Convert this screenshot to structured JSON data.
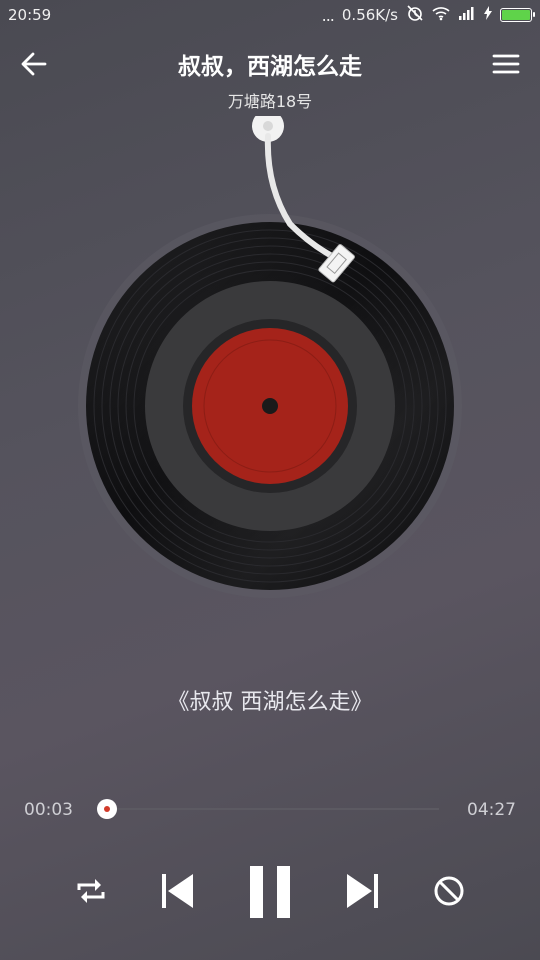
{
  "status_bar": {
    "time": "20:59",
    "dots": "...",
    "net_speed": "0.56K/s",
    "icons": [
      "alarm-off-icon",
      "wifi-icon",
      "signal-icon",
      "charging-icon",
      "battery-icon"
    ],
    "battery_color": "#5fd34a"
  },
  "header": {
    "title": "叔叔，西湖怎么走",
    "subtitle": "万塘路18号",
    "back_icon": "arrow-left-icon",
    "menu_icon": "hamburger-menu-icon"
  },
  "player": {
    "lyric": "《叔叔 西湖怎么走》",
    "current_time": "00:03",
    "total_time": "04:27",
    "progress": 0.011,
    "accent_color": "#d23a2a",
    "controls": [
      "repeat-icon",
      "previous-icon",
      "pause-icon",
      "next-icon",
      "block-icon"
    ]
  }
}
